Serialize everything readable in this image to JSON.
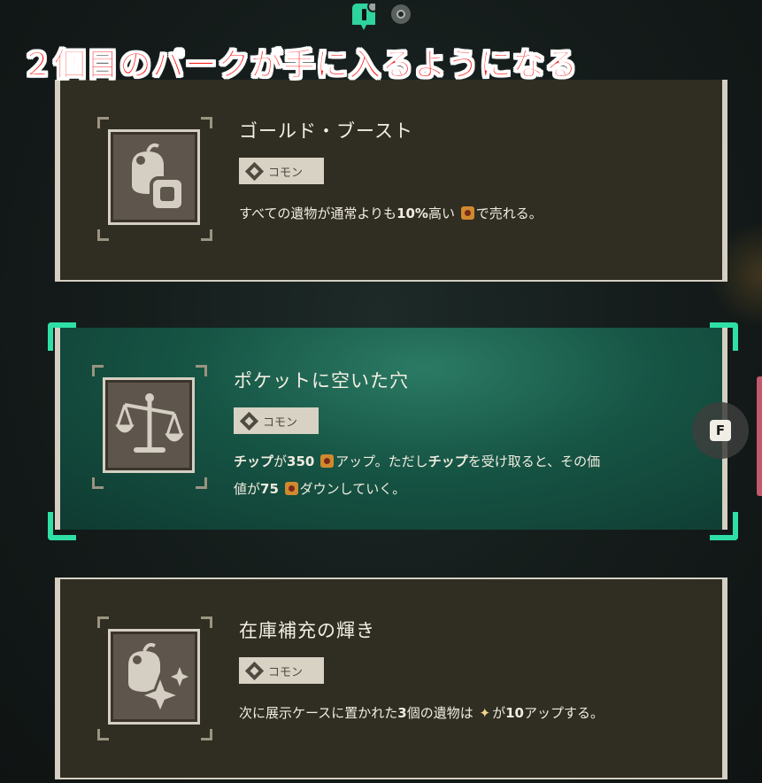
{
  "overlay": {
    "caption": "２個目のパークが手に入るようになる"
  },
  "pager": {
    "active_icon": "perk-tab-icon",
    "inactive_icon": "relic-tab-icon"
  },
  "perks": [
    {
      "title": "ゴールド・ブースト",
      "rarity": "コモン",
      "icon": "gold-boost-icon",
      "desc_parts": [
        "すべての遺物が通常よりも",
        "10%",
        "高い",
        "で売れる。"
      ]
    },
    {
      "title": "ポケットに空いた穴",
      "rarity": "コモン",
      "icon": "scale-icon",
      "desc_parts": [
        "チップ",
        "が",
        "350",
        "アップ。ただし",
        "チップ",
        "を受け取ると、その価",
        "値が",
        "75",
        "ダウンしていく。"
      ]
    },
    {
      "title": "在庫補充の輝き",
      "rarity": "コモン",
      "icon": "restock-sparkle-icon",
      "desc_parts": [
        "次に展示ケースに置かれた",
        "3",
        "個の遺物は",
        "が",
        "10",
        "アップする。"
      ]
    }
  ],
  "key_hint": {
    "key": "F"
  },
  "colors": {
    "accent": "#2fe0a6",
    "card_bg": "#302d23",
    "selected_bg": "#165444",
    "caption": "#ff1c1c"
  }
}
